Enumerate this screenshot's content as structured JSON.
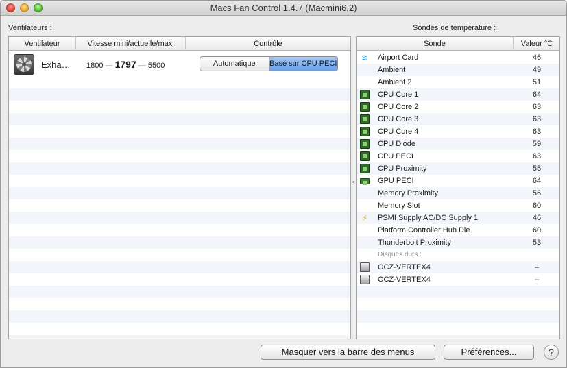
{
  "window": {
    "title": "Macs Fan Control 1.4.7 (Macmini6,2)"
  },
  "fans": {
    "label": "Ventilateurs :",
    "columns": [
      "Ventilateur",
      "Vitesse mini/actuelle/maxi",
      "Contrôle"
    ],
    "rows": [
      {
        "name": "Exha…",
        "min": "1800",
        "sep1": "—",
        "current": "1797",
        "sep2": "—",
        "max": "5500",
        "control_options": [
          "Automatique",
          "Basé sur CPU PECI"
        ],
        "selected_control": "Basé sur CPU PECI"
      }
    ]
  },
  "sensors": {
    "label": "Sondes de température :",
    "columns": [
      "Sonde",
      "Valeur °C"
    ],
    "rows": [
      {
        "icon": "wifi-icon",
        "name": "Airport Card",
        "value": "46"
      },
      {
        "icon": "",
        "name": "Ambient",
        "value": "49"
      },
      {
        "icon": "",
        "name": "Ambient 2",
        "value": "51"
      },
      {
        "icon": "cpu-chip-icon",
        "name": "CPU Core 1",
        "value": "64"
      },
      {
        "icon": "cpu-chip-icon",
        "name": "CPU Core 2",
        "value": "63"
      },
      {
        "icon": "cpu-chip-icon",
        "name": "CPU Core 3",
        "value": "63"
      },
      {
        "icon": "cpu-chip-icon",
        "name": "CPU Core 4",
        "value": "63"
      },
      {
        "icon": "cpu-chip-icon",
        "name": "CPU Diode",
        "value": "59"
      },
      {
        "icon": "cpu-chip-icon",
        "name": "CPU PECI",
        "value": "63"
      },
      {
        "icon": "cpu-chip-icon",
        "name": "CPU Proximity",
        "value": "55"
      },
      {
        "icon": "gpu-card-icon",
        "name": "GPU PECI",
        "value": "64"
      },
      {
        "icon": "",
        "name": "Memory Proximity",
        "value": "56"
      },
      {
        "icon": "",
        "name": "Memory Slot",
        "value": "60"
      },
      {
        "icon": "power-bolt-icon",
        "name": "PSMI Supply AC/DC Supply 1",
        "value": "46"
      },
      {
        "icon": "",
        "name": "Platform Controller Hub Die",
        "value": "60"
      },
      {
        "icon": "",
        "name": "Thunderbolt Proximity",
        "value": "53"
      }
    ],
    "disks_label": "Disques durs :",
    "disks": [
      {
        "icon": "hard-disk-icon",
        "name": "OCZ-VERTEX4",
        "value": "–"
      },
      {
        "icon": "hard-disk-icon",
        "name": "OCZ-VERTEX4",
        "value": "–"
      }
    ]
  },
  "buttons": {
    "hide": "Masquer vers la barre des menus",
    "preferences": "Préférences...",
    "help": "?"
  }
}
